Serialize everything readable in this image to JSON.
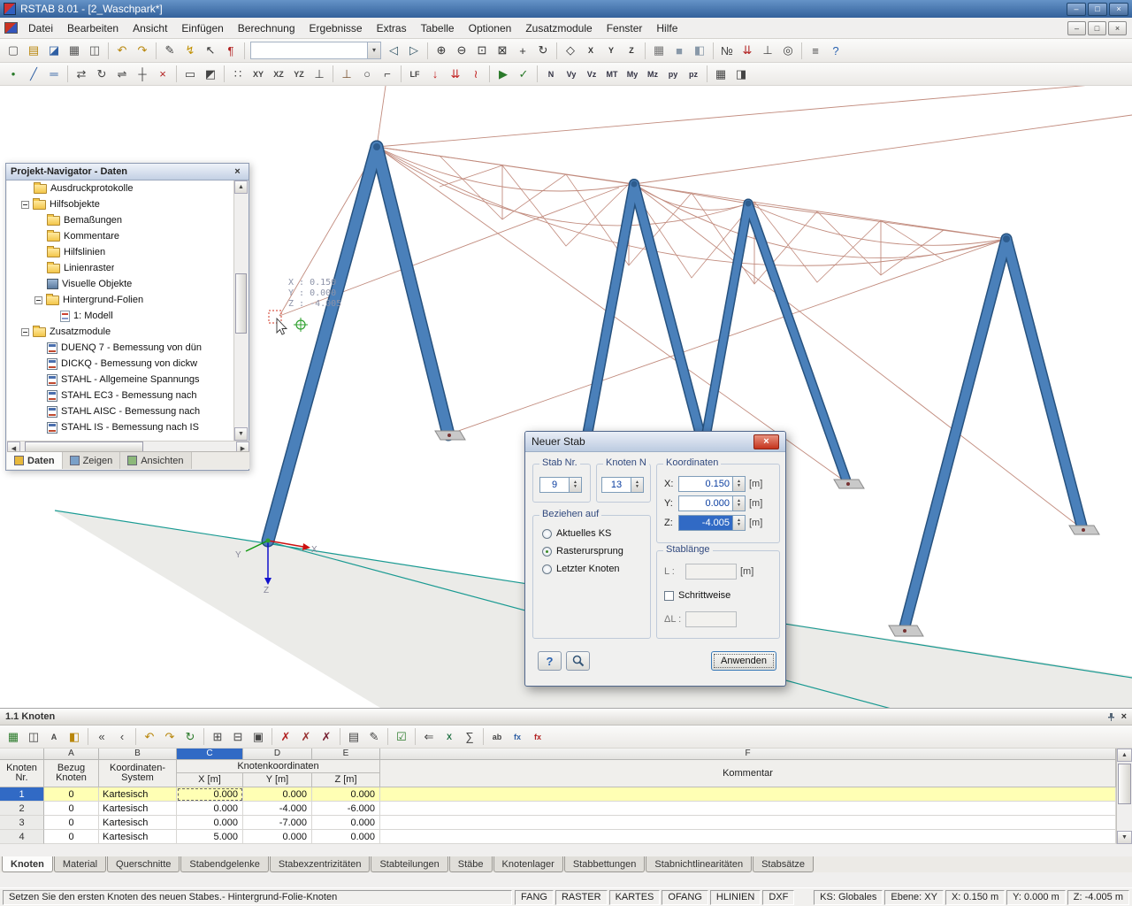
{
  "window": {
    "title": "RSTAB 8.01 - [2_Waschpark*]",
    "buttons": [
      {
        "name": "minimize-button",
        "glyph": "–"
      },
      {
        "name": "maximize-button",
        "glyph": "□"
      },
      {
        "name": "close-button",
        "glyph": "×"
      }
    ]
  },
  "menu": {
    "items": [
      "Datei",
      "Bearbeiten",
      "Ansicht",
      "Einfügen",
      "Berechnung",
      "Ergebnisse",
      "Extras",
      "Tabelle",
      "Optionen",
      "Zusatzmodule",
      "Fenster",
      "Hilfe"
    ],
    "mdi_buttons": [
      {
        "name": "mdi-minimize-button",
        "glyph": "–"
      },
      {
        "name": "mdi-restore-button",
        "glyph": "□"
      },
      {
        "name": "mdi-close-button",
        "glyph": "×"
      }
    ]
  },
  "toolbar1": {
    "icons": [
      {
        "n": "new-file",
        "g": "▢",
        "c": "#555555"
      },
      {
        "n": "open-file",
        "g": "▤",
        "c": "#b8860b"
      },
      {
        "n": "save",
        "g": "◪",
        "c": "#2f5fa3"
      },
      {
        "n": "print",
        "g": "▦",
        "c": "#555555"
      },
      {
        "n": "print-preview",
        "g": "◫",
        "c": "#555555"
      },
      {
        "sep": true
      },
      {
        "n": "undo",
        "g": "↶",
        "c": "#b8860b"
      },
      {
        "n": "redo",
        "g": "↷",
        "c": "#b8860b"
      },
      {
        "sep": true
      },
      {
        "n": "edit-mode",
        "g": "✎",
        "c": "#444444"
      },
      {
        "n": "snap-lightning",
        "g": "↯",
        "c": "#c09000"
      },
      {
        "n": "select-pointer",
        "g": "↖",
        "c": "#333333"
      },
      {
        "n": "comment-flag",
        "g": "¶",
        "c": "#b22222"
      },
      {
        "sep": true
      },
      {
        "n": "view-selector-combo",
        "combo": true
      },
      {
        "n": "nav-previous",
        "g": "◁",
        "c": "#335566"
      },
      {
        "n": "nav-next",
        "g": "▷",
        "c": "#335566"
      },
      {
        "sep": true
      },
      {
        "n": "zoom-in",
        "g": "⊕",
        "c": "#333333"
      },
      {
        "n": "zoom-out",
        "g": "⊖",
        "c": "#333333"
      },
      {
        "n": "zoom-window",
        "g": "⊡",
        "c": "#333333"
      },
      {
        "n": "zoom-all",
        "g": "⊠",
        "c": "#333333"
      },
      {
        "n": "pan",
        "g": "+",
        "c": "#333333"
      },
      {
        "n": "rotate-view",
        "g": "↻",
        "c": "#333333"
      },
      {
        "sep": true
      },
      {
        "n": "view-isometric",
        "g": "◇",
        "c": "#333333"
      },
      {
        "n": "view-x",
        "g": "X",
        "c": "#333333",
        "small": true
      },
      {
        "n": "view-y",
        "g": "Y",
        "c": "#333333",
        "small": true
      },
      {
        "n": "view-z",
        "g": "Z",
        "c": "#333333",
        "small": true
      },
      {
        "sep": true
      },
      {
        "n": "display-wireframe",
        "g": "▦",
        "c": "#777777"
      },
      {
        "n": "display-solid",
        "g": "■",
        "c": "#8898a8"
      },
      {
        "n": "display-transparent",
        "g": "◧",
        "c": "#8898a8"
      },
      {
        "sep": true
      },
      {
        "n": "show-numbering",
        "g": "№",
        "c": "#444444"
      },
      {
        "n": "show-loads",
        "g": "⇊",
        "c": "#b22222"
      },
      {
        "n": "show-supports",
        "g": "⊥",
        "c": "#444444"
      },
      {
        "n": "show-axes",
        "g": "◎",
        "c": "#444444"
      },
      {
        "sep": true
      },
      {
        "n": "display-options",
        "g": "≡",
        "c": "#444444"
      },
      {
        "n": "help",
        "g": "?",
        "c": "#2a62b0"
      }
    ]
  },
  "toolbar2": {
    "icons": [
      {
        "n": "new-node",
        "g": "•",
        "c": "#2a7a2a"
      },
      {
        "n": "new-member",
        "g": "╱",
        "c": "#2f5fa3"
      },
      {
        "n": "new-member-set",
        "g": "═",
        "c": "#2f5fa3"
      },
      {
        "sep": true
      },
      {
        "n": "move-copy",
        "g": "⇄",
        "c": "#444444"
      },
      {
        "n": "rotate",
        "g": "↻",
        "c": "#444444"
      },
      {
        "n": "mirror",
        "g": "⇌",
        "c": "#444444"
      },
      {
        "n": "divide-member",
        "g": "┼",
        "c": "#444444"
      },
      {
        "n": "delete-objects",
        "g": "×",
        "c": "#b22222"
      },
      {
        "sep": true
      },
      {
        "n": "select-all",
        "g": "▭",
        "c": "#444444"
      },
      {
        "n": "select-special",
        "g": "◩",
        "c": "#444444"
      },
      {
        "sep": true
      },
      {
        "n": "snap-grid",
        "g": "∷",
        "c": "#444444"
      },
      {
        "n": "work-plane-xy",
        "g": "XY",
        "c": "#444444",
        "small": true
      },
      {
        "n": "work-plane-xz",
        "g": "XZ",
        "c": "#444444",
        "small": true
      },
      {
        "n": "work-plane-yz",
        "g": "YZ",
        "c": "#444444",
        "small": true
      },
      {
        "n": "plane-offset",
        "g": "⊥",
        "c": "#444444"
      },
      {
        "sep": true
      },
      {
        "n": "nodal-support",
        "g": "⊥",
        "c": "#7a5230"
      },
      {
        "n": "member-hinge",
        "g": "○",
        "c": "#444444"
      },
      {
        "n": "member-eccentricity",
        "g": "⌐",
        "c": "#444444"
      },
      {
        "sep": true
      },
      {
        "n": "load-case",
        "g": "LF",
        "c": "#444444",
        "small": true
      },
      {
        "n": "nodal-load",
        "g": "↓",
        "c": "#c22222"
      },
      {
        "n": "member-load",
        "g": "⇊",
        "c": "#c22222"
      },
      {
        "n": "imperfection",
        "g": "≀",
        "c": "#c22222"
      },
      {
        "sep": true
      },
      {
        "n": "calculate",
        "g": "▶",
        "c": "#2a7a2a"
      },
      {
        "n": "plausibility-check",
        "g": "✓",
        "c": "#2a7a2a"
      },
      {
        "sep": true
      },
      {
        "n": "results-n",
        "g": "N",
        "c": "#333344",
        "small": true
      },
      {
        "n": "results-vy",
        "g": "Vy",
        "c": "#333344",
        "small": true
      },
      {
        "n": "results-vz",
        "g": "Vz",
        "c": "#333344",
        "small": true
      },
      {
        "n": "results-mt",
        "g": "MT",
        "c": "#333344",
        "small": true
      },
      {
        "n": "results-my",
        "g": "My",
        "c": "#333344",
        "small": true
      },
      {
        "n": "results-mz",
        "g": "Mz",
        "c": "#333344",
        "small": true
      },
      {
        "n": "results-py",
        "g": "py",
        "c": "#333344",
        "small": true
      },
      {
        "n": "results-pz",
        "g": "pz",
        "c": "#333344",
        "small": true
      },
      {
        "sep": true
      },
      {
        "n": "toggle-tables",
        "g": "▦",
        "c": "#444444"
      },
      {
        "n": "toggle-panel",
        "g": "◨",
        "c": "#444444"
      }
    ]
  },
  "navigator": {
    "title": "Projekt-Navigator - Daten",
    "items": [
      {
        "label": "Ausdruckprotokolle",
        "level": 2,
        "icon": "folder"
      },
      {
        "label": "Hilfsobjekte",
        "level": 2,
        "icon": "folder",
        "exp": true
      },
      {
        "label": "Bemaßungen",
        "level": 3,
        "icon": "folder-dim"
      },
      {
        "label": "Kommentare",
        "level": 3,
        "icon": "folder-comment"
      },
      {
        "label": "Hilfslinien",
        "level": 3,
        "icon": "folder-helplines"
      },
      {
        "label": "Linienraster",
        "level": 3,
        "icon": "folder-linegrid"
      },
      {
        "label": "Visuelle Objekte",
        "level": 3,
        "icon": "visual"
      },
      {
        "label": "Hintergrund-Folien",
        "level": 3,
        "icon": "folder-layers",
        "exp": true
      },
      {
        "label": "1: Modell",
        "level": 4,
        "icon": "dxf"
      },
      {
        "label": "Zusatzmodule",
        "level": 2,
        "icon": "folder-modules",
        "exp": true
      },
      {
        "label": "DUENQ 7 - Bemessung von dün",
        "level": 3,
        "icon": "mod-duenq"
      },
      {
        "label": "DICKQ - Bemessung von dickw",
        "level": 3,
        "icon": "mod-dickq"
      },
      {
        "label": "STAHL - Allgemeine Spannungs",
        "level": 3,
        "icon": "mod-stahl"
      },
      {
        "label": "STAHL EC3 - Bemessung nach",
        "level": 3,
        "icon": "mod-ec3"
      },
      {
        "label": "STAHL AISC - Bemessung nach",
        "level": 3,
        "icon": "mod-aisc"
      },
      {
        "label": "STAHL IS - Bemessung nach IS",
        "level": 3,
        "icon": "mod-is"
      }
    ],
    "tabs": [
      "Daten",
      "Zeigen",
      "Ansichten"
    ]
  },
  "viewport": {
    "coord": {
      "x": "X :  0.150",
      "y": "Y :  0.000",
      "z": "Z : -4.005"
    },
    "axes": {
      "x": "X",
      "y": "Y",
      "z": "Z"
    }
  },
  "dialog": {
    "title": "Neuer Stab",
    "stab": {
      "caption": "Stab Nr.",
      "value": "9"
    },
    "knoten": {
      "caption": "Knoten N",
      "value": "13"
    },
    "koordinaten": {
      "caption": "Koordinaten",
      "rows": [
        {
          "label": "X:",
          "value": "0.150",
          "unit": "[m]",
          "selected": false
        },
        {
          "label": "Y:",
          "value": "0.000",
          "unit": "[m]",
          "selected": false
        },
        {
          "label": "Z:",
          "value": "-4.005",
          "unit": "[m]",
          "selected": true
        }
      ]
    },
    "beziehen": {
      "caption": "Beziehen auf",
      "options": [
        {
          "label": "Aktuelles KS",
          "selected": false
        },
        {
          "label": "Rasterursprung",
          "selected": true
        },
        {
          "label": "Letzter Knoten",
          "selected": false
        }
      ]
    },
    "stablaenge": {
      "caption": "Stablänge",
      "l_label": "L :",
      "l_unit": "[m]",
      "checkbox": "Schrittweise",
      "dl_label": "ΔL :"
    },
    "help_label": "?",
    "apply_label": "Anwenden"
  },
  "table_panel": {
    "title": "1.1 Knoten",
    "toolbar_icons": [
      {
        "n": "table-settings",
        "g": "▦",
        "c": "#2a7a2a"
      },
      {
        "n": "table-views",
        "g": "◫",
        "c": "#444444"
      },
      {
        "n": "table-font",
        "g": "A",
        "c": "#444444",
        "small": true
      },
      {
        "n": "table-color",
        "g": "◧",
        "c": "#b8860b"
      },
      {
        "sep": true
      },
      {
        "n": "row-first",
        "g": "«",
        "c": "#444444"
      },
      {
        "n": "row-previous",
        "g": "‹",
        "c": "#444444"
      },
      {
        "sep": true
      },
      {
        "n": "table-undo",
        "g": "↶",
        "c": "#b8860b"
      },
      {
        "n": "table-redo",
        "g": "↷",
        "c": "#b8860b"
      },
      {
        "n": "table-refresh",
        "g": "↻",
        "c": "#2a7a2a"
      },
      {
        "sep": true
      },
      {
        "n": "copy-row",
        "g": "⊞",
        "c": "#444444"
      },
      {
        "n": "insert-row",
        "g": "⊟",
        "c": "#444444"
      },
      {
        "n": "block-select",
        "g": "▣",
        "c": "#444444"
      },
      {
        "sep": true
      },
      {
        "n": "delete-row",
        "g": "✗",
        "c": "#b22222"
      },
      {
        "n": "delete-column",
        "g": "✗",
        "c": "#993333"
      },
      {
        "n": "delete-table",
        "g": "✗",
        "c": "#772233"
      },
      {
        "sep": true
      },
      {
        "n": "view-grid",
        "g": "▤",
        "c": "#444444"
      },
      {
        "n": "edit-cell",
        "g": "✎",
        "c": "#444444"
      },
      {
        "sep": true
      },
      {
        "n": "check-entries",
        "g": "☑",
        "c": "#2a7a2a"
      },
      {
        "sep": true
      },
      {
        "n": "import-data",
        "g": "⇐",
        "c": "#444444"
      },
      {
        "n": "export-excel",
        "g": "X",
        "c": "#1d6f42",
        "small": true
      },
      {
        "n": "sum",
        "g": "∑",
        "c": "#444444"
      },
      {
        "sep": true
      },
      {
        "n": "rename-ab",
        "g": "ab",
        "c": "#444444",
        "small": true
      },
      {
        "n": "formula-fx",
        "g": "fx",
        "c": "#2f5fa3",
        "small": true
      },
      {
        "n": "formula-delete",
        "g": "fx",
        "c": "#b22222",
        "small": true
      }
    ],
    "letters": [
      "",
      "A",
      "B",
      "C",
      "D",
      "E",
      "F"
    ],
    "headers": {
      "nr": [
        "Knoten",
        "Nr."
      ],
      "bezug": [
        "Bezug",
        "Knoten"
      ],
      "system": [
        "Koordinaten-",
        "System"
      ],
      "group": "Knotenkoordinaten",
      "x": "X [m]",
      "y": "Y [m]",
      "z": "Z [m]",
      "comment": "Kommentar"
    },
    "rows": [
      {
        "nr": "1",
        "bezug": "0",
        "system": "Kartesisch",
        "x": "0.000",
        "y": "0.000",
        "z": "0.000",
        "comment": "",
        "selected": true
      },
      {
        "nr": "2",
        "bezug": "0",
        "system": "Kartesisch",
        "x": "0.000",
        "y": "-4.000",
        "z": "-6.000",
        "comment": "",
        "selected": false
      },
      {
        "nr": "3",
        "bezug": "0",
        "system": "Kartesisch",
        "x": "0.000",
        "y": "-7.000",
        "z": "0.000",
        "comment": "",
        "selected": false
      },
      {
        "nr": "4",
        "bezug": "0",
        "system": "Kartesisch",
        "x": "5.000",
        "y": "0.000",
        "z": "0.000",
        "comment": "",
        "selected": false
      }
    ],
    "tabs": [
      "Knoten",
      "Material",
      "Querschnitte",
      "Stabendgelenke",
      "Stabexzentrizitäten",
      "Stabteilungen",
      "Stäbe",
      "Knotenlager",
      "Stabbettungen",
      "Stabnichtlinearitäten",
      "Stabsätze"
    ]
  },
  "statusbar": {
    "message": "Setzen Sie den ersten Knoten des neuen Stabes.- Hintergrund-Folie-Knoten",
    "toggles": [
      "FANG",
      "RASTER",
      "KARTES",
      "OFANG",
      "HLINIEN",
      "DXF"
    ],
    "fields": [
      "KS: Globales",
      "Ebene: XY",
      "X:  0.150 m",
      "Y:  0.000 m",
      "Z:  -4.005 m"
    ]
  }
}
